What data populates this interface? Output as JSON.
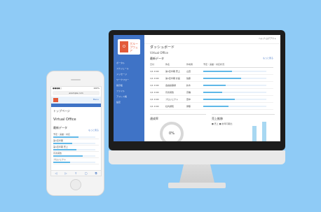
{
  "desktop": {
    "logo_text": "グループウェア",
    "logo_badge": "O",
    "topbar_links": "ヘルプ  ログアウト",
    "nav_items": [
      "ポータル",
      "スケジュール",
      "メッセージ",
      "ワークフロー",
      "掲示板",
      "ファイル",
      "アドレス帳",
      "設定"
    ],
    "page_title": "ダッシュボード",
    "site_name": "Virtual Office",
    "section_title": "最新データ",
    "section_link": "もっと見る",
    "table_headers": [
      "日付",
      "件名",
      "作成者",
      "予定・実績・対応状況"
    ],
    "table_rows": [
      {
        "date": "1/1 9:00",
        "subject": "第1四半期 売上",
        "author": "山田",
        "progress": 0.45
      },
      {
        "date": "1/1 9:00",
        "subject": "第1四半期 計画",
        "author": "佐藤",
        "progress": 0.6
      },
      {
        "date": "1/1 9:00",
        "subject": "会議議事録",
        "author": "鈴木",
        "progress": 0.35
      },
      {
        "date": "1/1 9:00",
        "subject": "月次報告",
        "author": "高橋",
        "progress": 0.3
      },
      {
        "date": "1/1 9:00",
        "subject": "プロジェクト",
        "author": "田中",
        "progress": 0.5
      },
      {
        "date": "1/1 9:00",
        "subject": "社内通知",
        "author": "伊藤",
        "progress": 0.4
      }
    ],
    "card_left_title": "達成率",
    "card_left_link": "もっと見る",
    "donut_value": "0%",
    "card_right_title": "売上推移",
    "card_right_link": "もっと見る",
    "card_right_legend": "■ 売上   ■ 前年同期比",
    "colors": {
      "sidebar": "#3f73c6",
      "accent": "#5fb8e8",
      "brand": "#e35b3a"
    }
  },
  "mobile": {
    "status_left": "●●●●○ ",
    "status_right": "100%",
    "url": "example.com",
    "header_right": "Menu",
    "top_label": "トップページ",
    "site_name": "Virtual Office",
    "section_title": "最新データ",
    "list_link": "もっと見る",
    "rows": [
      {
        "label": "予定・実績・対応",
        "progress": 0.6
      },
      {
        "label": "第1四半期",
        "progress": 0.45
      },
      {
        "label": "第1四半期 売上",
        "progress": 0.55
      },
      {
        "label": "月次報告",
        "progress": 0.7
      },
      {
        "label": "プロジェクト",
        "progress": 0.4
      }
    ],
    "bottom_icons": [
      "◁",
      "▷",
      "⇪",
      "▢",
      "⧉"
    ]
  }
}
